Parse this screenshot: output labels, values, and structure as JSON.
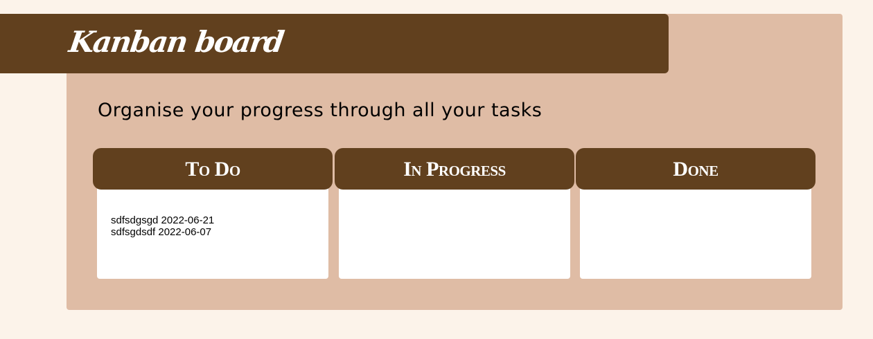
{
  "header": {
    "title": "Kanban board",
    "subtitle": "Organise your progress through all your tasks"
  },
  "columns": [
    {
      "title": "To Do",
      "tasks": [
        "sdfsdgsgd 2022-06-21",
        "sdfsgdsdf 2022-06-07"
      ]
    },
    {
      "title": "In Progress",
      "tasks": []
    },
    {
      "title": "Done",
      "tasks": []
    }
  ],
  "colors": {
    "page_background": "#fcf3ea",
    "board_background": "#dfbca5",
    "header_brown": "#61401e",
    "card_white": "#ffffff"
  }
}
